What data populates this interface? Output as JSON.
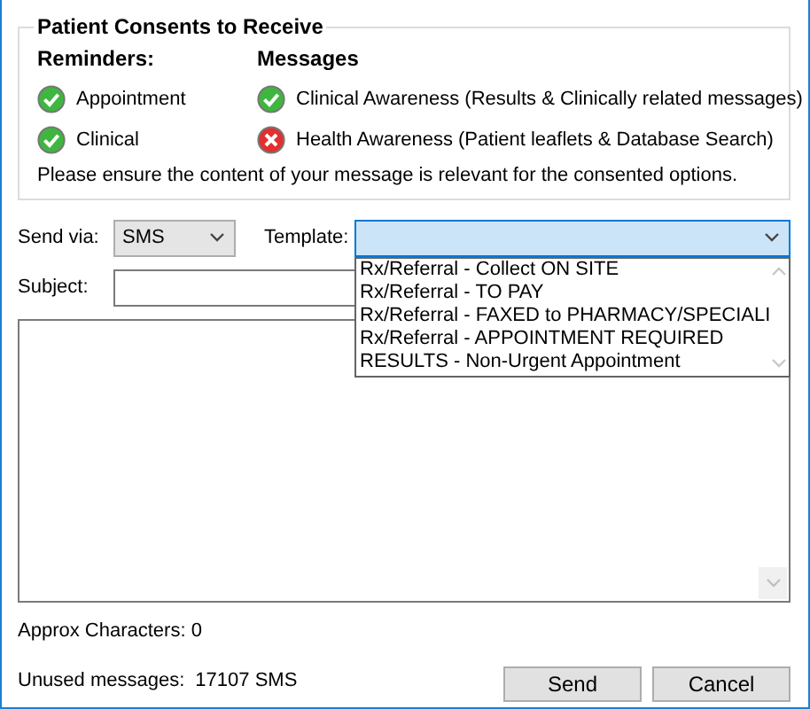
{
  "consents": {
    "title": "Patient Consents to Receive",
    "reminders": {
      "heading": "Reminders:",
      "items": [
        {
          "label": "Appointment",
          "consented": true
        },
        {
          "label": "Clinical",
          "consented": true
        }
      ]
    },
    "messages": {
      "heading": "Messages",
      "items": [
        {
          "label": "Clinical Awareness (Results & Clinically related messages)",
          "consented": true
        },
        {
          "label": "Health Awareness (Patient leaflets & Database Search)",
          "consented": false
        }
      ]
    },
    "note": "Please ensure the content of your message is relevant for the consented options."
  },
  "send_via": {
    "label": "Send via:",
    "value": "SMS"
  },
  "template": {
    "label": "Template:",
    "expanded": true,
    "options": [
      {
        "label": "Rx/Referral - Collect ON SITE"
      },
      {
        "label": "Rx/Referral - TO PAY"
      },
      {
        "label": "Rx/Referral - FAXED to PHARMACY/SPECIALI"
      },
      {
        "label": "Rx/Referral - APPOINTMENT REQUIRED"
      },
      {
        "label": "RESULTS - Non-Urgent Appointment"
      }
    ]
  },
  "subject": {
    "label": "Subject:"
  },
  "approx_characters": "Approx Characters: 0",
  "unused_messages": {
    "label": "Unused messages:",
    "value": "17107 SMS"
  },
  "buttons": [
    {
      "label": "Send"
    },
    {
      "label": "Cancel"
    }
  ]
}
